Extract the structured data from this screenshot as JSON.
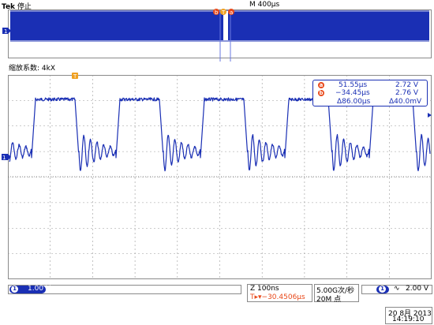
{
  "header": {
    "brand": "Tek",
    "run_state": "停止",
    "timebase": "M 400μs"
  },
  "zoom": {
    "label": "缩放系数: 4kX"
  },
  "markers": {
    "cursor_a": "a",
    "cursor_b": "b",
    "trigger": "T",
    "channel_1": "1"
  },
  "cursor_readout": {
    "a_time": "51.55μs",
    "a_volts": "2.72 V",
    "b_time": "−34.45μs",
    "b_volts": "2.76 V",
    "delta_time": "Δ86.00μs",
    "delta_volts": "Δ40.0mV"
  },
  "status_bar": {
    "ch1_scale": "1.00 V",
    "zoom_time_div": "Z 100ns",
    "trigger_position": "T▸▾−30.4506μs",
    "sample_rate": "5.00G次/秒",
    "record_length": "20M 点",
    "trigger_source": "1",
    "trigger_slope": "∿",
    "trigger_level": "2.00 V",
    "date": "20 8月 2013",
    "time": "14:19:10"
  },
  "colors": {
    "trace": "#1a2fb4",
    "cursor_marker": "#e8491a",
    "trigger_marker": "#f0a020",
    "grid": "#9a9a9a",
    "cursor_line": "#6a78e0"
  }
}
